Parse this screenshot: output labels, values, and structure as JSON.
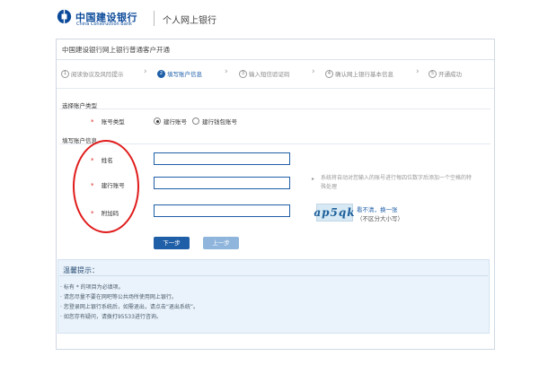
{
  "header": {
    "brand_cn": "中国建设银行",
    "brand_en": "China Construction Bank",
    "title": "个人网上银行"
  },
  "panel": {
    "title": "中国建设银行网上银行普通客户开通"
  },
  "steps": [
    {
      "num": "1",
      "label": "阅读协议及风险提示",
      "active": false
    },
    {
      "num": "2",
      "label": "填写账户信息",
      "active": true
    },
    {
      "num": "3",
      "label": "输入短信验证码",
      "active": false
    },
    {
      "num": "4",
      "label": "确认网上银行基本信息",
      "active": false
    },
    {
      "num": "5",
      "label": "开通成功",
      "active": false
    }
  ],
  "account_type": {
    "section_title": "选择账户类型",
    "required_mark": "*",
    "label": "账号类型",
    "options": [
      "建行账号",
      "建行钱包账号"
    ],
    "selected": "建行账号"
  },
  "account_info": {
    "section_title": "填写账户信息",
    "fields": [
      {
        "required_mark": "*",
        "label": "姓名",
        "value": ""
      },
      {
        "required_mark": "*",
        "label": "建行账号",
        "value": ""
      },
      {
        "required_mark": "*",
        "label": "附加码",
        "value": ""
      }
    ],
    "hint_arrow": "▸",
    "hint": "系统将自动对您输入的账号进行每四位数字后添加一个空格的特殊处理",
    "captcha_text": "ap5qk",
    "refresh_link": "看不清，换一张",
    "case_note": "（不区分大小写）"
  },
  "buttons": {
    "next": "下一步",
    "prev": "上一步"
  },
  "tips": {
    "title": "温馨提示：",
    "items": [
      "· 标有 * 的项目为必填项。",
      "· 请您尽量不要在网吧等公共场所使用网上银行。",
      "· 您登录网上银行系统后，如需退出，请点击“退出系统”。",
      "· 如您存有疑问，请拨打95533进行咨询。"
    ]
  },
  "colors": {
    "brand_blue": "#0b4a9a",
    "accent_blue": "#1f5fa8",
    "required_red": "#dd2222",
    "annotation_red": "#e01b1b",
    "tips_bg": "#eaf3fb"
  }
}
